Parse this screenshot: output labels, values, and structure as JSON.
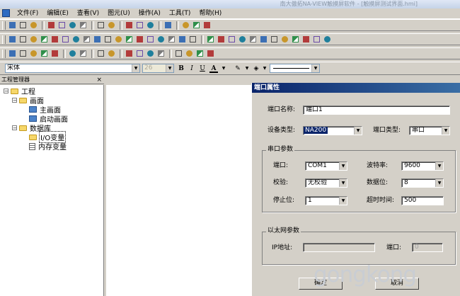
{
  "window": {
    "title": "南大傲拓NA-VIEW触摸屏软件 - [触摸屏测试界面.hmi]"
  },
  "menu": {
    "items": [
      {
        "label": "文件(F)"
      },
      {
        "label": "编辑(E)"
      },
      {
        "label": "查看(V)"
      },
      {
        "label": "图元(U)"
      },
      {
        "label": "操作(A)"
      },
      {
        "label": "工具(T)"
      },
      {
        "label": "帮助(H)"
      }
    ]
  },
  "toolbar1": {
    "icons": [
      "new-file-icon",
      "open-folder-icon",
      "save-icon",
      "|",
      "cut-icon",
      "copy-icon",
      "paste-icon",
      "delete-icon",
      "|",
      "undo-icon",
      "redo-icon",
      "|",
      "print-preview-icon",
      "print-icon",
      "help-icon",
      "|",
      "screen-settings-icon",
      "|",
      "zoom-in-icon",
      "zoom-out-icon",
      "zoom-fit-icon"
    ]
  },
  "toolbar2": {
    "icons": [
      "pointer-icon",
      "line-icon",
      "polyline-icon",
      "rectangle-icon",
      "rounded-rect-icon",
      "ellipse-icon",
      "button-icon",
      "text-box-icon",
      "ocx-icon",
      "image-icon",
      "gauge-icon",
      "meter-icon",
      "trend-icon",
      "bar-chart-icon",
      "alarm-icon",
      "record-icon",
      "circle-icon",
      "table-icon",
      "|",
      "align-left-icon",
      "align-center-icon",
      "align-right-icon",
      "align-top-icon",
      "align-middle-icon",
      "align-bottom-icon",
      "same-width-icon",
      "same-height-icon",
      "same-size-icon",
      "space-h-icon",
      "space-v-icon",
      "library-icon"
    ]
  },
  "toolbar3": {
    "icons": [
      "grid-icon",
      "snap-icon",
      "group-icon",
      "ungroup-icon",
      "combine-icon",
      "|",
      "flip-h-icon",
      "flip-v-icon",
      "|",
      "rotate-icon",
      "rotate-left-icon",
      "|",
      "bring-front-icon",
      "send-back-icon",
      "bring-forward-icon",
      "send-backward-icon",
      "|",
      "layer-top-icon",
      "layer-bottom-icon",
      "layer-icon",
      "lock-icon"
    ]
  },
  "format": {
    "font_name": "宋体",
    "font_size": "26",
    "bold": "B",
    "italic": "I",
    "underline": "U",
    "font_color": "A"
  },
  "project_panel": {
    "title": "工程管理器",
    "close": "×",
    "root": "工程",
    "screens": "画面",
    "main_screen": "主画面",
    "startup_screen": "启动画面",
    "database": "数据库",
    "io_vars": "I/O变量",
    "mem_vars": "内存变量",
    "expander_collapse": "−"
  },
  "dialog": {
    "title": "端口属性",
    "port_name_label": "端口名称:",
    "port_name_value": "端口1",
    "device_type_label": "设备类型:",
    "device_type_value": "NA200",
    "port_type_label": "端口类型:",
    "port_type_value": "串口",
    "serial_group": "串口参数",
    "port_label": "端口:",
    "port_value": "COM1",
    "baud_label": "波特率:",
    "baud_value": "9600",
    "parity_label": "校验:",
    "parity_value": "无校验",
    "databits_label": "数据位:",
    "databits_value": "8",
    "stopbits_label": "停止位:",
    "stopbits_value": "1",
    "timeout_label": "超时时间:",
    "timeout_value": "500",
    "ethernet_group": "以太网参数",
    "ip_label": "IP地址:",
    "eth_port_label": "端口:",
    "eth_port_value": "0",
    "ok_label": "确定",
    "cancel_label": "取消"
  },
  "watermark": "gongkong"
}
